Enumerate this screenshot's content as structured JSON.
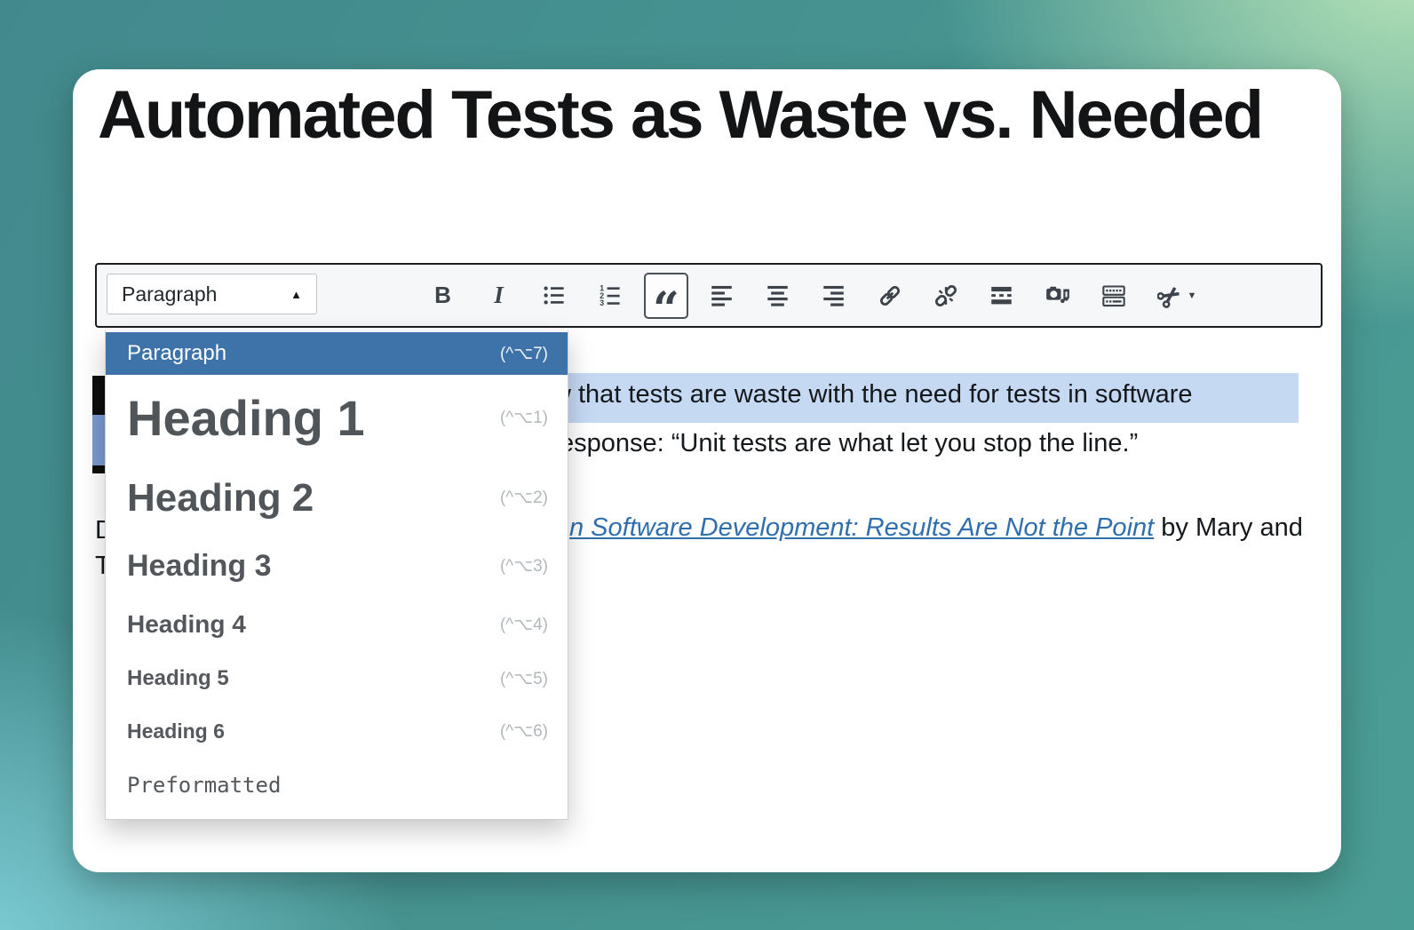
{
  "document": {
    "title": "Automated Tests as Waste vs. Needed",
    "selected_line_fragment": "w that tests are waste with the need for tests in software",
    "quote_line_fragment": "esponse: “Unit tests are what let you stop the line.”",
    "paragraph_first_letter": "D",
    "paragraph_second_line_letter": "T",
    "link_text_fragment": "n Software Development: Results Are Not the Point",
    "link_suffix_fragment": " by Mary and"
  },
  "toolbar": {
    "format_button": {
      "label": "Paragraph",
      "caret": "▲"
    },
    "buttons": [
      {
        "name": "bold",
        "label": "B"
      },
      {
        "name": "italic",
        "label": "I"
      },
      {
        "name": "bulleted-list"
      },
      {
        "name": "numbered-list"
      },
      {
        "name": "blockquote",
        "active": true,
        "glyph": "“"
      },
      {
        "name": "align-left"
      },
      {
        "name": "align-center"
      },
      {
        "name": "align-right"
      },
      {
        "name": "insert-link"
      },
      {
        "name": "remove-link"
      },
      {
        "name": "read-more"
      },
      {
        "name": "add-media"
      },
      {
        "name": "keyboard-shortcuts"
      },
      {
        "name": "scissors",
        "caret": "▼"
      }
    ]
  },
  "format_menu": {
    "items": [
      {
        "label": "Paragraph",
        "shortcut": "(^⌥7)",
        "selected": true
      },
      {
        "label": "Heading 1",
        "shortcut": "(^⌥1)"
      },
      {
        "label": "Heading 2",
        "shortcut": "(^⌥2)"
      },
      {
        "label": "Heading 3",
        "shortcut": "(^⌥3)"
      },
      {
        "label": "Heading 4",
        "shortcut": "(^⌥4)"
      },
      {
        "label": "Heading 5",
        "shortcut": "(^⌥5)"
      },
      {
        "label": "Heading 6",
        "shortcut": "(^⌥6)"
      },
      {
        "label": "Preformatted",
        "shortcut": ""
      }
    ]
  },
  "colors": {
    "menu_selected_bg": "#3d73a9",
    "selection_highlight": "#c5d9f3",
    "link_blue": "#2f6fad",
    "toolbar_icon": "#3c434a"
  }
}
